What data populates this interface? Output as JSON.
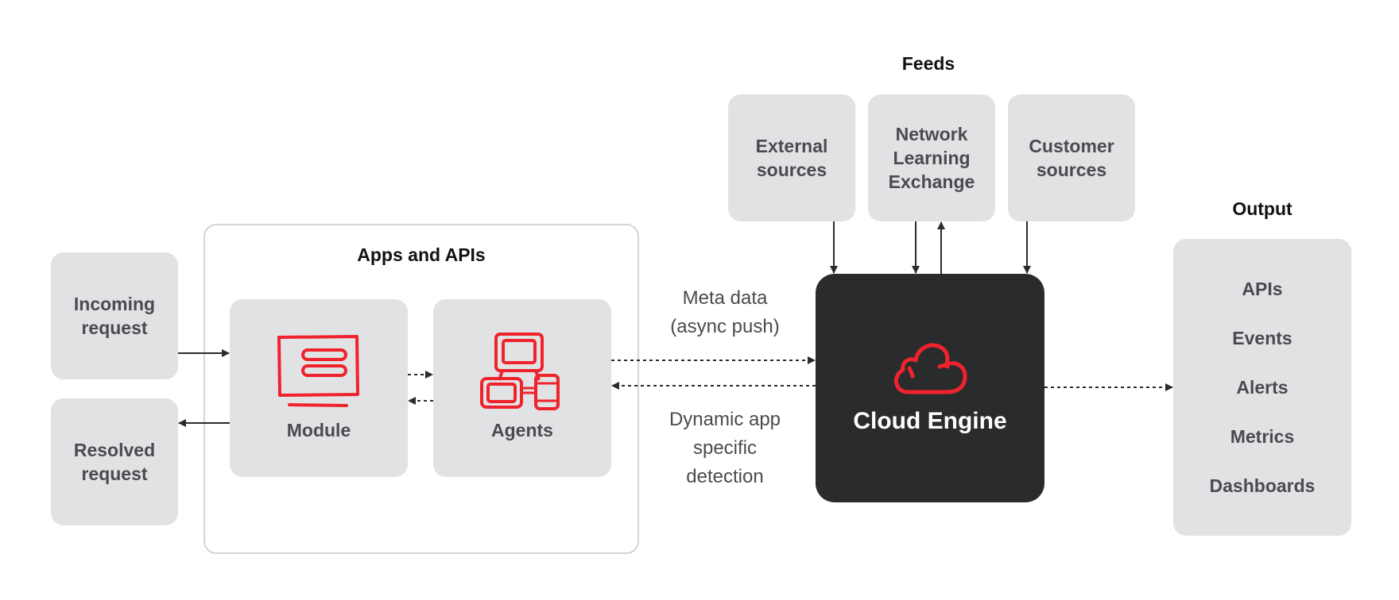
{
  "left": {
    "incoming": "Incoming request",
    "resolved": "Resolved request"
  },
  "apps": {
    "title": "Apps and APIs",
    "module": "Module",
    "agents": "Agents"
  },
  "links": {
    "meta_line1": "Meta data",
    "meta_line2": "(async push)",
    "dyn_line1": "Dynamic app",
    "dyn_line2": "specific",
    "dyn_line3": "detection"
  },
  "feeds": {
    "title": "Feeds",
    "items": [
      {
        "label": "External sources"
      },
      {
        "label": "Network Learning Exchange"
      },
      {
        "label": "Customer sources"
      }
    ]
  },
  "engine": {
    "title": "Cloud Engine",
    "icon": "cloud-icon"
  },
  "output": {
    "title": "Output",
    "items": [
      "APIs",
      "Events",
      "Alerts",
      "Metrics",
      "Dashboards"
    ]
  },
  "colors": {
    "accent": "#f0232d",
    "box": "#e1e2e4",
    "engine": "#2a2b2d",
    "text": "#4a4b4e"
  }
}
